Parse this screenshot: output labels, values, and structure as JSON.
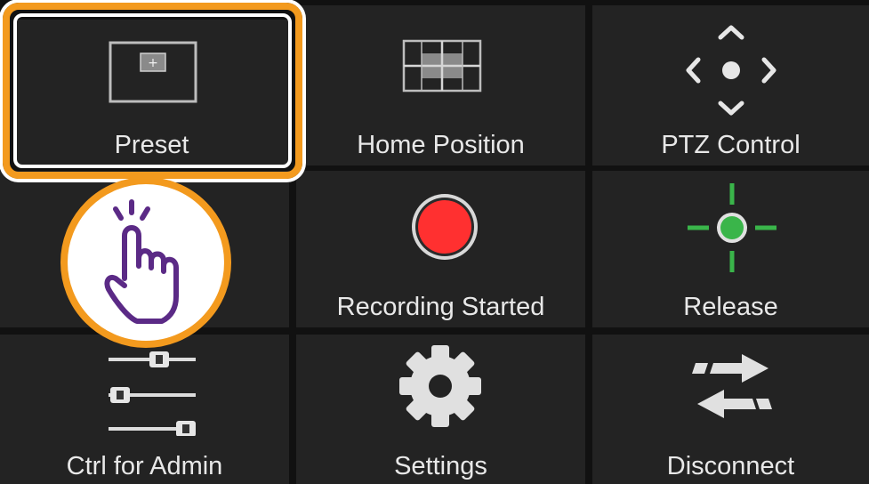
{
  "tiles": {
    "preset": "Preset",
    "home_position": "Home Position",
    "ptz_control": "PTZ Control",
    "recording": "Recording Started",
    "release": "Release",
    "ctrl_admin": "Ctrl for Admin",
    "settings": "Settings",
    "disconnect": "Disconnect"
  },
  "icons": {
    "preset": "preset-frame-icon",
    "home_position": "home-position-grid-icon",
    "ptz_control": "ptz-arrows-icon",
    "recording": "record-icon",
    "release": "crosshair-target-icon",
    "ctrl_admin": "sliders-icon",
    "settings": "gear-icon",
    "disconnect": "swap-arrows-icon",
    "touch_hint": "tap-hand-icon"
  },
  "colors": {
    "highlight": "#f39a1e",
    "record": "#ff3030",
    "release_green": "#3ab54a",
    "hand_purple": "#5b2a86"
  }
}
